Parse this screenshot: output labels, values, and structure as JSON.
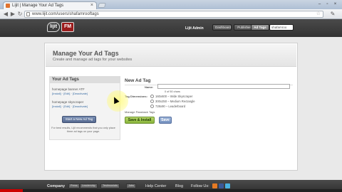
{
  "browser": {
    "tab_title": "Lijit | Manage Your Ad Tags",
    "url": "www.lijit.com/users/shafamrooftags",
    "window_min": "–",
    "window_max": "▫",
    "window_close": "×"
  },
  "header": {
    "logo_lijit": "lijit",
    "logo_fm": "FM",
    "admin_label": "Lijit Admin",
    "nav": [
      "Dashboard",
      "Publisher Tools",
      "Ad Tags"
    ],
    "active": "Ad Tags",
    "search_value": "shafamroo"
  },
  "page": {
    "title": "Manage Your Ad Tags",
    "subtitle": "Create and manage ad tags for your websites"
  },
  "sidebar": {
    "heading": "Your Ad Tags",
    "tags": [
      {
        "name": "homepage banner ATF",
        "links": "[Install] · [Edit] · [Deactivate]"
      },
      {
        "name": "homepage skyscraper",
        "links": "[Install] · [Edit] · [Deactivate]"
      }
    ],
    "start_button": "Start a New Ad Tag",
    "note": "For best results, Lijit recommends that you only place three ad tags on your page."
  },
  "form": {
    "title": "New Ad Tag",
    "name_label": "Name:",
    "name_value": "",
    "char_count": "0 of 50 chars",
    "dimensions_label": "Tag Dimensions:",
    "options": [
      "160x600 – Wide Skyscraper",
      "300x250 – Medium Rectangle",
      "728x90 – Leaderboard"
    ],
    "passback_label": "Manage Passback Tags",
    "save_install": "Save & Install",
    "save": "Save"
  },
  "footer": {
    "company": "Company",
    "links": [
      "Press",
      "Leadership",
      "Testimonials",
      "Jobs"
    ],
    "help": "Help Center",
    "blog": "Blog",
    "follow": "Follow Us:"
  },
  "colors": {
    "header_bg": "#3a3a3a",
    "green_button": "#98c04a",
    "blue_button": "#7d98c6",
    "fm_red": "#9b1c1c"
  }
}
